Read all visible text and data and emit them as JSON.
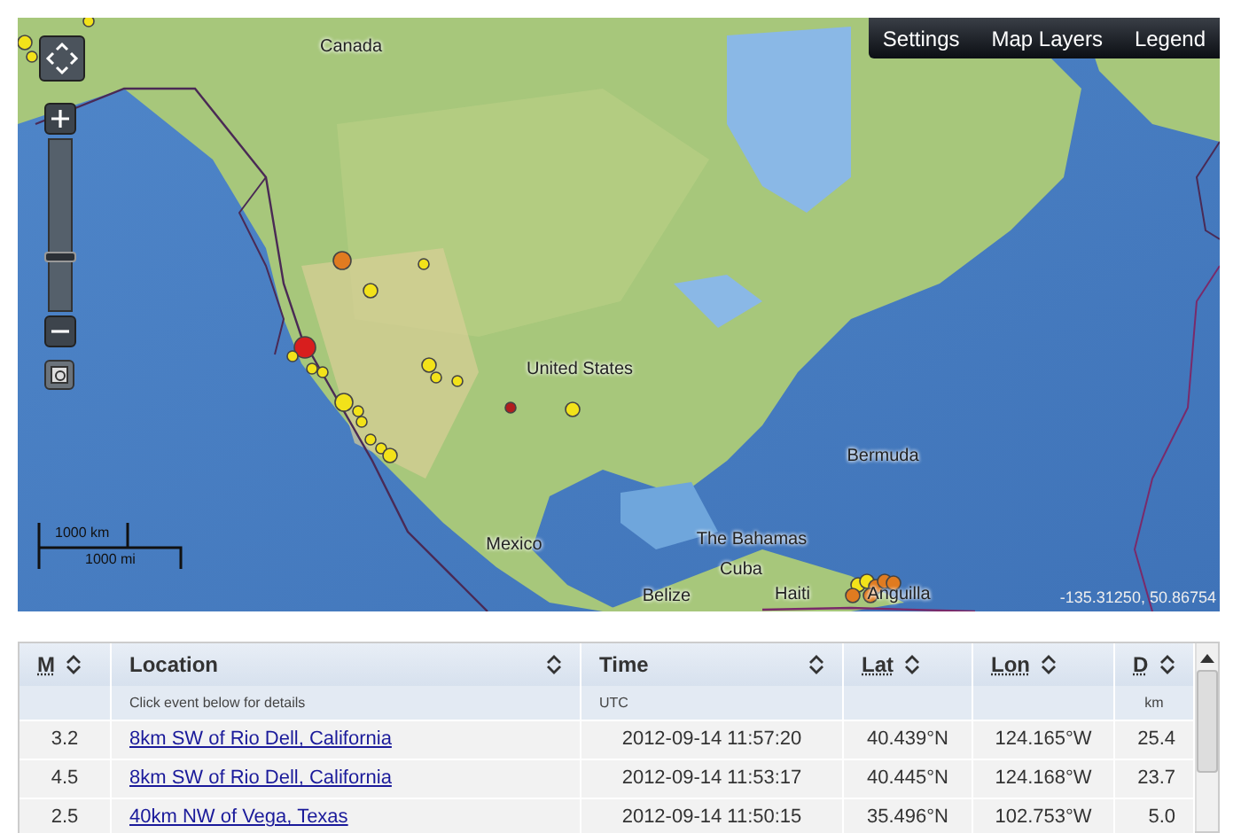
{
  "map": {
    "toolbar": [
      {
        "label": "Settings"
      },
      {
        "label": "Map Layers"
      },
      {
        "label": "Legend"
      }
    ],
    "zoom": {
      "level": 0.3
    },
    "labels": [
      {
        "text": "Canada"
      },
      {
        "text": "United States"
      },
      {
        "text": "Bermuda"
      },
      {
        "text": "Mexico"
      },
      {
        "text": "The Bahamas"
      },
      {
        "text": "Cuba"
      },
      {
        "text": "Belize"
      },
      {
        "text": "Haiti"
      },
      {
        "text": "Anguilla"
      }
    ],
    "scale": {
      "km": "1000 km",
      "mi": "1000 mi"
    },
    "coordinates": "-135.31250, 50.86754"
  },
  "table": {
    "columns": [
      {
        "label": "M",
        "abbreviation": true
      },
      {
        "label": "Location",
        "abbreviation": false,
        "subtitle": "Click event below for details"
      },
      {
        "label": "Time",
        "abbreviation": false,
        "subtitle": "UTC"
      },
      {
        "label": "Lat",
        "abbreviation": true
      },
      {
        "label": "Lon",
        "abbreviation": true
      },
      {
        "label": "D",
        "abbreviation": true,
        "subtitle": "km"
      }
    ],
    "rows": [
      {
        "magnitude": "3.2",
        "location": "8km SW of Rio Dell, California",
        "time": "2012-09-14 11:57:20",
        "lat": "40.439°N",
        "lon": "124.165°W",
        "depth": "25.4"
      },
      {
        "magnitude": "4.5",
        "location": "8km SW of Rio Dell, California",
        "time": "2012-09-14 11:53:17",
        "lat": "40.445°N",
        "lon": "124.168°W",
        "depth": "23.7"
      },
      {
        "magnitude": "2.5",
        "location": "40km NW of Vega, Texas",
        "time": "2012-09-14 11:50:15",
        "lat": "35.496°N",
        "lon": "102.753°W",
        "depth": "5.0"
      }
    ]
  }
}
